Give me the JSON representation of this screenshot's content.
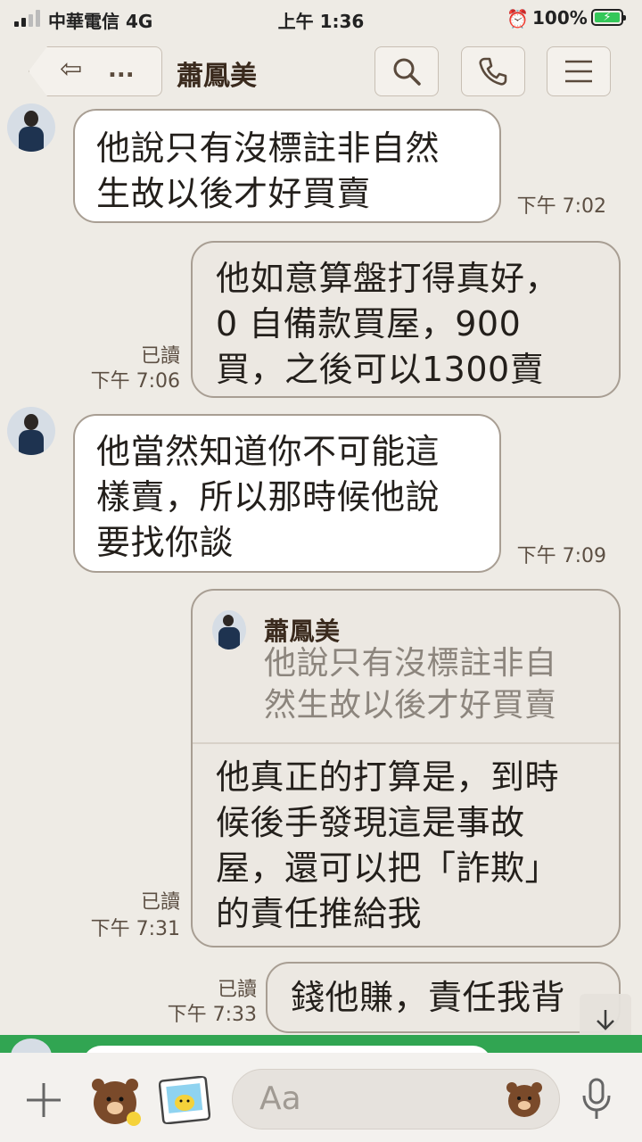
{
  "status_bar": {
    "carrier": "中華電信  4G",
    "time": "上午 1:36",
    "alarm_icon": "alarm-clock-icon",
    "battery": "100%",
    "battery_color": "#34c759"
  },
  "header": {
    "back_label": "...",
    "title": "蕭鳳美",
    "icons": [
      "back-arrow-icon",
      "search-icon",
      "phone-icon",
      "menu-icon"
    ]
  },
  "messages": [
    {
      "side": "in",
      "text": "他說只有沒標註非自然\n生故以後才好買賣",
      "time": "下午 7:02"
    },
    {
      "side": "out",
      "text": "他如意算盤打得真好，\n0 自備款買屋，900\n買，之後可以1300賣",
      "read": "已讀",
      "time": "下午 7:06"
    },
    {
      "side": "in",
      "text": "他當然知道你不可能這\n樣賣，所以那時候他說\n要找你談",
      "time": "下午 7:09"
    },
    {
      "side": "out",
      "reply_to": {
        "name": "蕭鳳美",
        "text": "他說只有沒標註非自\n然生故以後才好買賣"
      },
      "text": "他真正的打算是，到時\n候後手發現這是事故\n屋，還可以把「詐欺」\n的責任推給我",
      "read": "已讀",
      "time": "下午 7:31"
    },
    {
      "side": "out",
      "text": "錢他賺，責任我背",
      "read": "已讀",
      "time": "下午 7:33"
    }
  ],
  "input": {
    "placeholder": "Aa",
    "icons": [
      "plus-icon",
      "brown-bear-sticker-icon",
      "photo-sticker-icon",
      "emoji-icon",
      "microphone-icon",
      "scroll-down-icon"
    ]
  },
  "colors": {
    "background": "#eeebe5",
    "bubble_in": "#ffffff",
    "bubble_out": "#ece8e2",
    "accent_green": "#31a552"
  }
}
